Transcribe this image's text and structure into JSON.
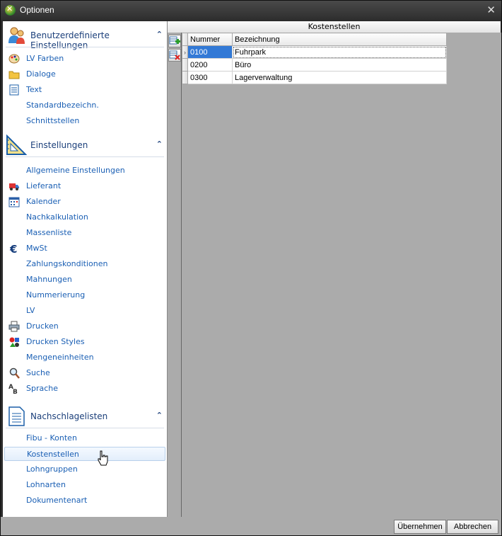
{
  "window": {
    "title": "Optionen"
  },
  "groups": [
    {
      "title": "Benutzerdefinierte Einstellungen",
      "icon": "users-icon",
      "items": [
        {
          "label": "LV Farben",
          "icon": "palette-icon"
        },
        {
          "label": "Dialoge",
          "icon": "folder-icon"
        },
        {
          "label": "Text",
          "icon": "document-icon"
        },
        {
          "label": "Standardbezeichn.",
          "icon": ""
        },
        {
          "label": "Schnittstellen",
          "icon": ""
        }
      ]
    },
    {
      "title": "Einstellungen",
      "icon": "ruler-icon",
      "items": [
        {
          "label": "Allgemeine Einstellungen",
          "icon": ""
        },
        {
          "label": "Lieferant",
          "icon": "truck-icon"
        },
        {
          "label": "Kalender",
          "icon": "calendar-icon"
        },
        {
          "label": "Nachkalkulation",
          "icon": ""
        },
        {
          "label": "Massenliste",
          "icon": ""
        },
        {
          "label": "MwSt",
          "icon": "euro-icon"
        },
        {
          "label": "Zahlungskonditionen",
          "icon": ""
        },
        {
          "label": "Mahnungen",
          "icon": ""
        },
        {
          "label": "Nummerierung",
          "icon": ""
        },
        {
          "label": "LV",
          "icon": ""
        },
        {
          "label": "Drucken",
          "icon": "printer-icon"
        },
        {
          "label": "Drucken Styles",
          "icon": "shapes-icon"
        },
        {
          "label": "Mengeneinheiten",
          "icon": ""
        },
        {
          "label": "Suche",
          "icon": "magnifier-icon"
        },
        {
          "label": "Sprache",
          "icon": "language-icon"
        }
      ]
    },
    {
      "title": "Nachschlagelisten",
      "icon": "list-document-icon",
      "items": [
        {
          "label": "Fibu - Konten",
          "icon": ""
        },
        {
          "label": "Kostenstellen",
          "icon": "",
          "selected": true
        },
        {
          "label": "Lohngruppen",
          "icon": ""
        },
        {
          "label": "Lohnarten",
          "icon": ""
        },
        {
          "label": "Dokumentenart",
          "icon": ""
        }
      ]
    }
  ],
  "panel": {
    "title": "Kostenstellen",
    "columns": [
      "Nummer",
      "Bezeichnung"
    ],
    "rows": [
      {
        "nummer": "0100",
        "bezeichnung": "Fuhrpark"
      },
      {
        "nummer": "0200",
        "bezeichnung": "Büro"
      },
      {
        "nummer": "0300",
        "bezeichnung": "Lagerverwaltung"
      }
    ],
    "current_row_indicator": "›"
  },
  "buttons": {
    "apply": "Übernehmen",
    "cancel": "Abbrechen"
  },
  "colors": {
    "link": "#1a5fb4",
    "header": "#1b3f7a",
    "selection": "#3279d6"
  }
}
